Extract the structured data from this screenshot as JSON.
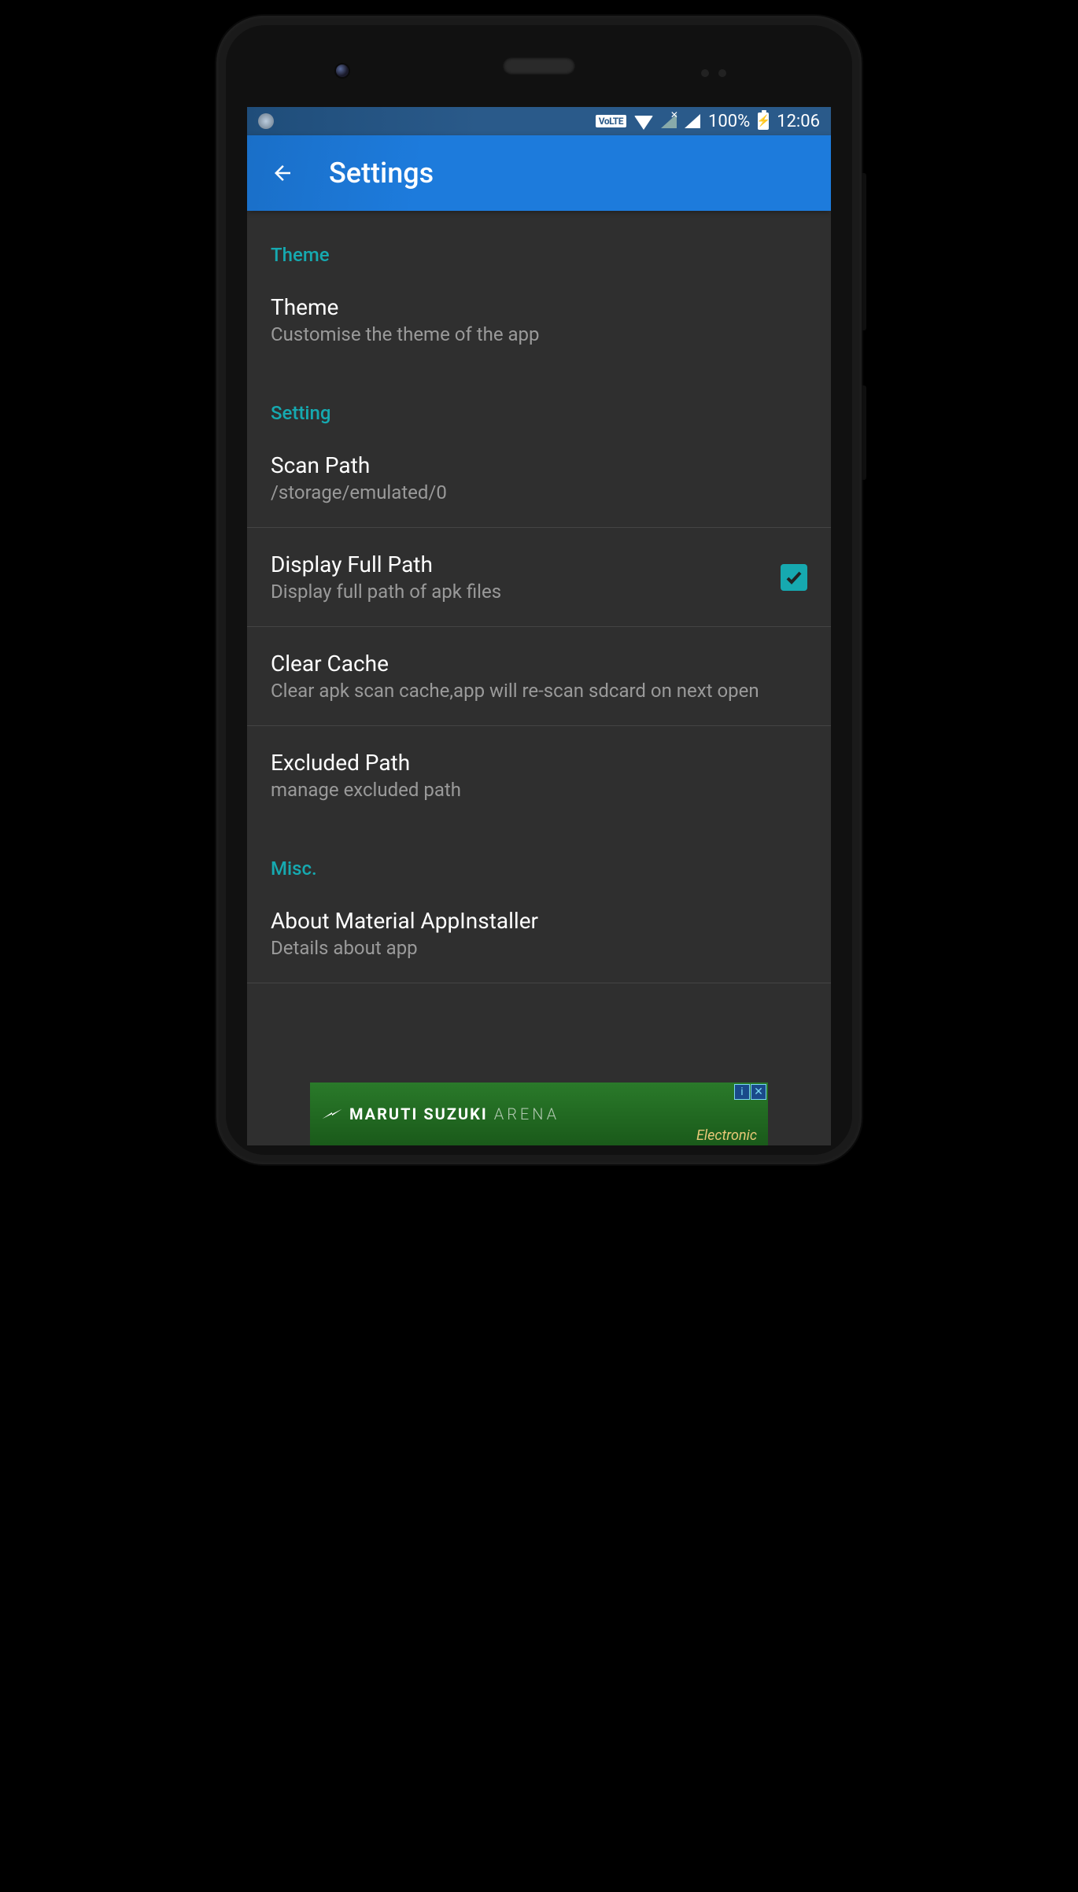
{
  "status": {
    "volte": "VoLTE",
    "battery_pct": "100%",
    "time": "12:06"
  },
  "appbar": {
    "title": "Settings"
  },
  "sections": {
    "theme_header": "Theme",
    "theme": {
      "title": "Theme",
      "sub": "Customise the theme of the app"
    },
    "setting_header": "Setting",
    "scan_path": {
      "title": "Scan Path",
      "sub": "/storage/emulated/0"
    },
    "display_full_path": {
      "title": "Display Full Path",
      "sub": "Display full path of apk files",
      "checked": true
    },
    "clear_cache": {
      "title": "Clear Cache",
      "sub": "Clear apk scan cache,app will re-scan sdcard on next open"
    },
    "excluded_path": {
      "title": "Excluded Path",
      "sub": "manage excluded path"
    },
    "misc_header": "Misc.",
    "about": {
      "title": "About Material AppInstaller",
      "sub": "Details about app"
    }
  },
  "ad": {
    "brand": "MARUTI SUZUKI",
    "sub": "ARENA",
    "corner_info": "i",
    "corner_close": "✕",
    "bottom": "Electronic"
  }
}
